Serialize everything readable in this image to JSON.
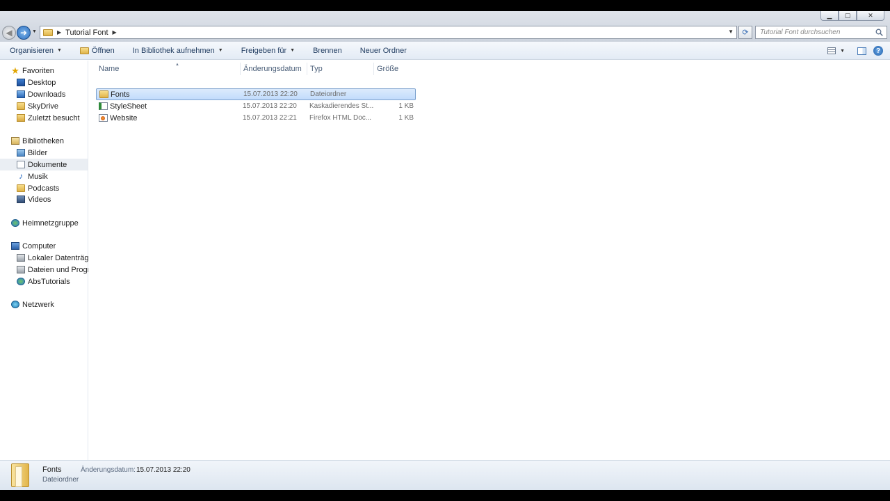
{
  "window": {
    "caption": {
      "minimize": "▁",
      "maximize": "▢",
      "close": "✕"
    }
  },
  "address": {
    "path": "Tutorial Font"
  },
  "search": {
    "placeholder": "Tutorial Font durchsuchen"
  },
  "toolbar": {
    "organize": "Organisieren",
    "open": "Öffnen",
    "include_library": "In Bibliothek aufnehmen",
    "share": "Freigeben für",
    "burn": "Brennen",
    "new_folder": "Neuer Ordner",
    "help": "?"
  },
  "sidebar": {
    "favorites": "Favoriten",
    "desktop": "Desktop",
    "downloads": "Downloads",
    "skydrive": "SkyDrive",
    "recent": "Zuletzt besucht",
    "libraries": "Bibliotheken",
    "pictures": "Bilder",
    "documents": "Dokumente",
    "music": "Musik",
    "podcasts": "Podcasts",
    "videos": "Videos",
    "homegroup": "Heimnetzgruppe",
    "computer": "Computer",
    "local_disk": "Lokaler Datenträger",
    "programs_drive": "Dateien und Progran",
    "abs_tutorials": "AbsTutorials",
    "network": "Netzwerk"
  },
  "columns": {
    "name": "Name",
    "date": "Änderungsdatum",
    "type": "Typ",
    "size": "Größe"
  },
  "files": [
    {
      "name": "Fonts",
      "date": "15.07.2013 22:20",
      "type": "Dateiordner",
      "size": ""
    },
    {
      "name": "StyleSheet",
      "date": "15.07.2013 22:20",
      "type": "Kaskadierendes St...",
      "size": "1 KB"
    },
    {
      "name": "Website",
      "date": "15.07.2013 22:21",
      "type": "Firefox HTML Doc...",
      "size": "1 KB"
    }
  ],
  "details": {
    "name": "Fonts",
    "type": "Dateiordner",
    "date_label": "Änderungsdatum:",
    "date_value": "15.07.2013 22:20"
  }
}
